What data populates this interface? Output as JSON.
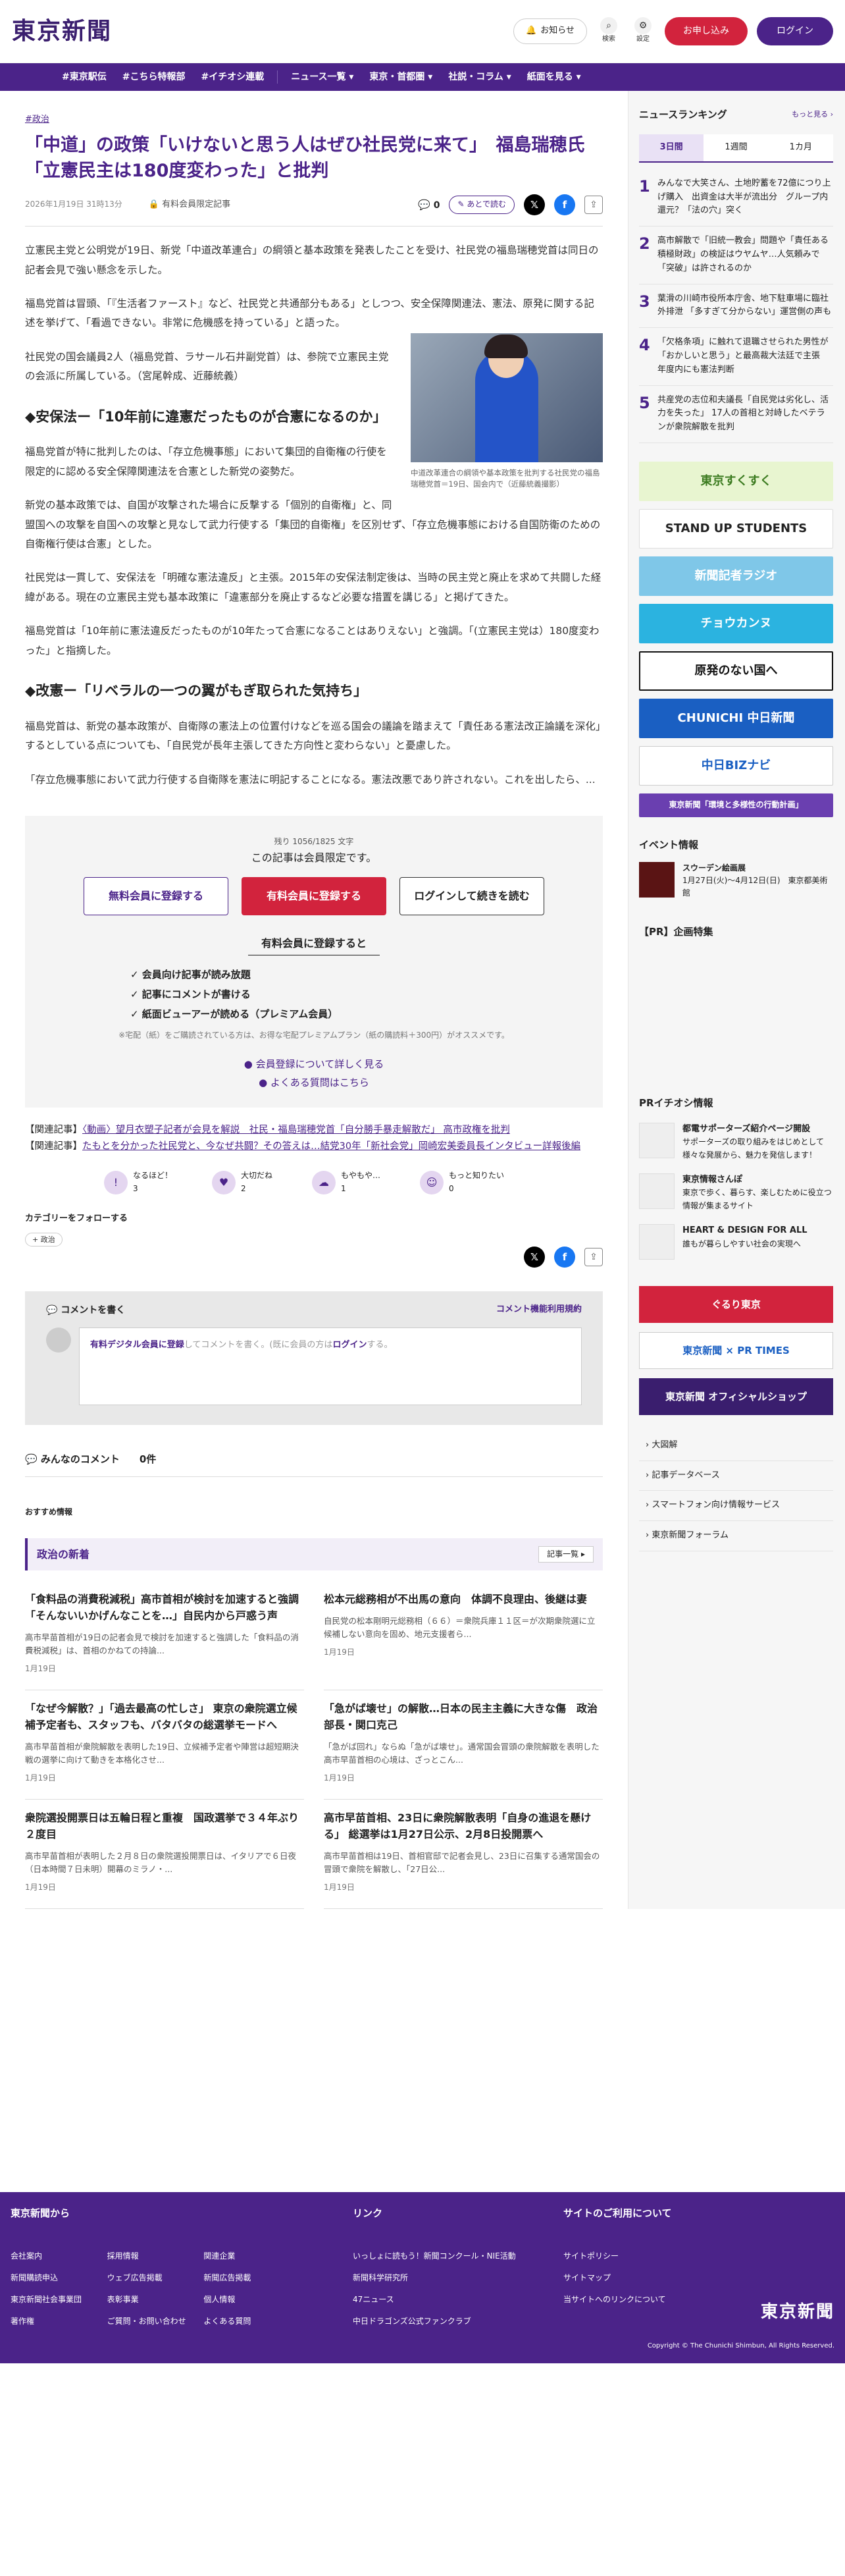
{
  "header": {
    "logo": "東京新聞",
    "notice": "お知らせ",
    "search": "検索",
    "settings": "設定",
    "apply": "お申し込み",
    "login": "ログイン"
  },
  "nav": [
    "#東京駅伝",
    "#こちら特報部",
    "#イチオシ連載",
    "ニュース一覧 ▾",
    "東京・首都圏 ▾",
    "社説・コラム ▾",
    "紙面を見る ▾"
  ],
  "article": {
    "category": "#政治",
    "title": "「中道」の政策「いけないと思う人はぜひ社民党に来て」　福島瑞穂氏「立憲民主は180度変わった」と批判",
    "date": "2026年1月19日 31時13分",
    "limited": "有料会員限定記事",
    "comment_count": "0",
    "read_later": "あとで読む",
    "p1": "立憲民主党と公明党が19日、新党「中道改革連合」の綱領と基本政策を発表したことを受け、社民党の福島瑞穂党首は同日の記者会見で強い懸念を示した。",
    "p2": "福島党首は冒頭、「『生活者ファースト』など、社民党と共通部分もある」としつつ、安全保障関連法、憲法、原発に関する記述を挙げて、「看過できない。非常に危機感を持っている」と語った。",
    "p3": "社民党の国会議員2人（福島党首、ラサール石井副党首）は、参院で立憲民主党の会派に所属している。（宮尾幹成、近藤統義）",
    "h2a": "◆安保法ー「10年前に違憲だったものが合憲になるのか」",
    "p4": "福島党首が特に批判したのは、「存立危機事態」において集団的自衛権の行使を限定的に認める安全保障関連法を合憲とした新党の姿勢だ。",
    "p5": "新党の基本政策では、自国が攻撃された場合に反撃する「個別的自衛権」と、同盟国への攻撃を自国への攻撃と見なして武力行使する「集団的自衛権」を区別せず、「存立危機事態における自国防衛のための自衛権行使は合憲」とした。",
    "p6": "社民党は一貫して、安保法を「明確な憲法違反」と主張。2015年の安保法制定後は、当時の民主党と廃止を求めて共闘した経緯がある。現在の立憲民主党も基本政策に「違憲部分を廃止するなど必要な措置を講じる」と掲げてきた。",
    "p7": "福島党首は「10年前に憲法違反だったものが10年たって合憲になることはありえない」と強調。「(立憲民主党は）180度変わった」と指摘した。",
    "h2b": "◆改憲ー「リベラルの一つの翼がもぎ取られた気持ち」",
    "p8": "福島党首は、新党の基本政策が、自衛隊の憲法上の位置付けなどを巡る国会の議論を踏まえて「責任ある憲法改正論議を深化」するとしている点についても、「自民党が長年主張してきた方向性と変わらない」と憂慮した。",
    "p9": "「存立危機事態において武力行使する自衛隊を憲法に明記することになる。憲法改悪であり許されない。これを出したら、...",
    "caption": "中道改革連合の綱領や基本政策を批判する社民党の福島瑞穂党首＝19日、国会内で（近藤統義撮影）"
  },
  "paywall": {
    "remain": "残り 1056/1825 文字",
    "limited": "この記事は会員限定です。",
    "btn_free": "無料会員に登録する",
    "btn_paid": "有料会員に登録する",
    "btn_login": "ログインして続きを読む",
    "heading": "有料会員に登録すると",
    "benefits": [
      "会員向け記事が読み放題",
      "記事にコメントが書ける",
      "紙面ビューアーが読める（プレミアム会員）"
    ],
    "note": "※宅配（紙）をご購読されている方は、お得な宅配プレミアムプラン（紙の購読料＋300円）がオススメです。",
    "link1": "会員登録について詳しく見る",
    "link2": "よくある質問はこちら"
  },
  "related": [
    {
      "label": "【関連記事】",
      "text": "〈動画〉望月衣塑子記者が会見を解説　社民・福島瑞穂党首「自分勝手暴走解散だ」 高市政権を批判"
    },
    {
      "label": "【関連記事】",
      "text": "たもとを分かった社民党と、今なぜ共闘？その答えは…結党30年「新社会党」岡崎宏美委員長インタビュー詳報後編"
    }
  ],
  "reactions": [
    {
      "label": "なるほど！",
      "count": "3"
    },
    {
      "label": "大切だね",
      "count": "2"
    },
    {
      "label": "もやもや…",
      "count": "1"
    },
    {
      "label": "もっと知りたい",
      "count": "0"
    }
  ],
  "follow": {
    "label": "カテゴリーをフォローする",
    "tag": "政治"
  },
  "comments": {
    "write": "コメントを書く",
    "rules": "コメント機能利用規約",
    "prompt_link": "有料デジタル会員に登録",
    "prompt_mid": "してコメントを書く。(既に会員の方は",
    "prompt_login": "ログイン",
    "prompt_end": "する。",
    "all": "みんなのコメント　　0件"
  },
  "recommend": {
    "label": "おすすめ情報",
    "section": "政治の新着",
    "more": "記事一覧 ▸",
    "cards": [
      {
        "title": "「食料品の消費税減税」高市首相が検討を加速すると強調「そんないいかげんなことを…」自民内から戸惑う声",
        "excerpt": "高市早苗首相が19日の記者会見で検討を加速すると強調した「食料品の消費税減税」は、首相のかねての持論...",
        "date": "1月19日"
      },
      {
        "title": "松本元総務相が不出馬の意向　体調不良理由、後継は妻",
        "excerpt": "自民党の松本剛明元総務相（６６）＝衆院兵庫１１区＝が次期衆院選に立候補しない意向を固め、地元支援者ら...",
        "date": "1月19日"
      },
      {
        "title": "「なぜ今解散？」「過去最高の忙しさ」 東京の衆院選立候補予定者も、スタッフも、バタバタの総選挙モードへ",
        "excerpt": "高市早苗首相が衆院解散を表明した19日、立候補予定者や陣営は超短期決戦の選挙に向けて動きを本格化させ...",
        "date": "1月19日"
      },
      {
        "title": "「急がば壊せ」の解散…日本の民主主義に大きな傷　政治部長・関口克己",
        "excerpt": "「急がば回れ」ならぬ「急がば壊せ」。通常国会冒頭の衆院解散を表明した高市早苗首相の心境は、ざっとこん...",
        "date": "1月19日"
      },
      {
        "title": "衆院選投開票日は五輪日程と重複　国政選挙で３４年ぶり２度目",
        "excerpt": "高市早苗首相が表明した２月８日の衆院選投開票日は、イタリアで６日夜（日本時間７日未明）開幕のミラノ・...",
        "date": "1月19日"
      },
      {
        "title": "高市早苗首相、23日に衆院解散表明「自身の進退を懸ける」 総選挙は1月27日公示、2月8日投開票へ",
        "excerpt": "高市早苗首相は19日、首相官邸で記者会見し、23日に召集する通常国会の冒頭で衆院を解散し、「27日公...",
        "date": "1月19日"
      }
    ]
  },
  "sidebar": {
    "ranking_title": "ニュースランキング",
    "ranking_more": "もっと見る ›",
    "tabs": [
      "3日間",
      "1週間",
      "1カ月"
    ],
    "ranking": [
      "みんなで大笑さん、土地貯蓄を72億につり上げ購入　出資金は大半が流出分　グループ内還元？「法の穴」突く",
      "高市解散で「旧統一教会」問題や「責任ある積極財政」の検証はウヤムヤ…人気頼みで「突破」は許されるのか",
      "葉滑の川崎市役所本庁舎、地下駐車場に臨社外排泄 「多すぎて分からない」運営側の声も",
      "「欠格条項」に触れて退職させられた男性が「おかしいと思う」と最高裁大法廷で主張　年度内にも憲法判断",
      "共産党の志位和夫議長「自民党は劣化し、活力を失った」 17人の首相と対峙したベテランが衆院解散を批判"
    ],
    "banners": [
      "東京すくすく",
      "STAND UP STUDENTS",
      "新聞記者ラジオ",
      "チョウカンヌ",
      "原発のない国へ",
      "CHUNICHI 中日新聞",
      "中日BIZナビ",
      "東京新聞「環境と多様性の行動計画」"
    ],
    "event_title": "イベント情報",
    "event_name": "スウーデン絵画展",
    "event_desc": "1月27日(火)〜4月12日(日)　東京都美術館",
    "pr_title": "【PR】企画特集",
    "pr2_title": "PRイチオシ情報",
    "pr_items": [
      {
        "t": "都電サポーターズ紹介ページ開設",
        "d": "サポーターズの取り組みをはじめとして様々な発展から、魅力を発信します！"
      },
      {
        "t": "東京情報さんぽ",
        "d": "東京で歩く、暮らす、楽しむために役立つ情報が集まるサイト"
      },
      {
        "t": "HEART & DESIGN FOR ALL",
        "d": "誰もが暮らしやすい社会の実現へ"
      }
    ],
    "bottom_banners": [
      "ぐるり東京",
      "東京新聞 × PR TIMES",
      "東京新聞 オフィシャルショップ"
    ],
    "links": [
      "大図解",
      "記事データベース",
      "スマートフォン向け情報サービス",
      "東京新聞フォーラム"
    ]
  },
  "footer": {
    "col1_title": "東京新聞から",
    "col1": [
      "会社案内",
      "採用情報",
      "関連企業",
      "新聞購読申込",
      "ウェブ広告掲載",
      "新聞広告掲載",
      "東京新聞社会事業団",
      "表彰事業",
      "個人情報",
      "著作権",
      "ご質問・お問い合わせ",
      "よくある質問"
    ],
    "col2_title": "リンク",
    "col2": [
      "いっしょに読もう！新聞コンクール・NIE活動",
      "新聞科学研究所",
      "47ニュース",
      "中日ドラゴンズ公式ファンクラブ"
    ],
    "col3_title": "サイトのご利用について",
    "col3": [
      "サイトポリシー",
      "サイトマップ",
      "当サイトへのリンクについて"
    ],
    "logo": "東京新聞",
    "copyright": "Copyright © The Chunichi Shimbun, All Rights Reserved."
  }
}
